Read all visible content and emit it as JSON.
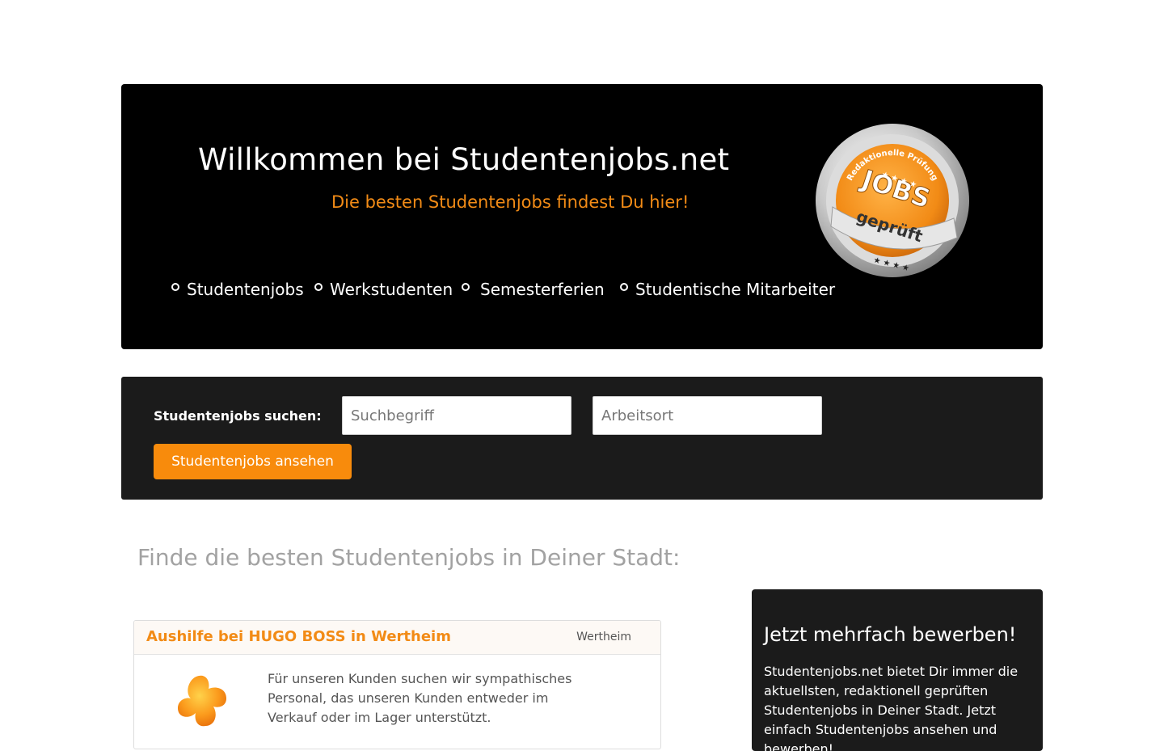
{
  "hero": {
    "title": "Willkommen bei Studentenjobs.net",
    "subtitle": "Die besten Studentenjobs findest Du hier!",
    "nav": [
      {
        "label": "Studentenjobs"
      },
      {
        "label": "Werkstudenten"
      },
      {
        "label": "Semesterferien"
      },
      {
        "label": "Studentische Mitarbeiter"
      }
    ],
    "seal": {
      "ring_text": "Redaktionelle Prüfung",
      "line1": "JOBS",
      "line2": "geprüft",
      "icon": "seal-badge-icon"
    }
  },
  "search": {
    "label": "Studentenjobs suchen:",
    "term_placeholder": "Suchbegriff",
    "location_placeholder": "Arbeitsort",
    "button_label": "Studentenjobs ansehen"
  },
  "city_section": {
    "heading": "Finde die besten Studentenjobs in Deiner Stadt:"
  },
  "jobs": [
    {
      "title": "Aushilfe bei HUGO BOSS in Wertheim",
      "location": "Wertheim",
      "description": "Für unseren Kunden suchen wir sympathisches Personal, das unseren Kunden entweder im Verkauf oder im Lager unterstützt.",
      "logo_icon": "company-logo-blob-icon"
    }
  ],
  "sidebar": {
    "title": "Jetzt mehrfach bewerben!",
    "text": "Studentenjobs.net bietet Dir immer die aktuellsten, redaktionell geprüften Studentenjobs in Deiner Stadt. Jetzt einfach Studentenjobs ansehen und bewerben!"
  },
  "colors": {
    "accent": "#f88b0c",
    "hero_bg": "#000000",
    "panel_bg": "#1b1b1b",
    "heading_grey": "#a2a2a2"
  }
}
